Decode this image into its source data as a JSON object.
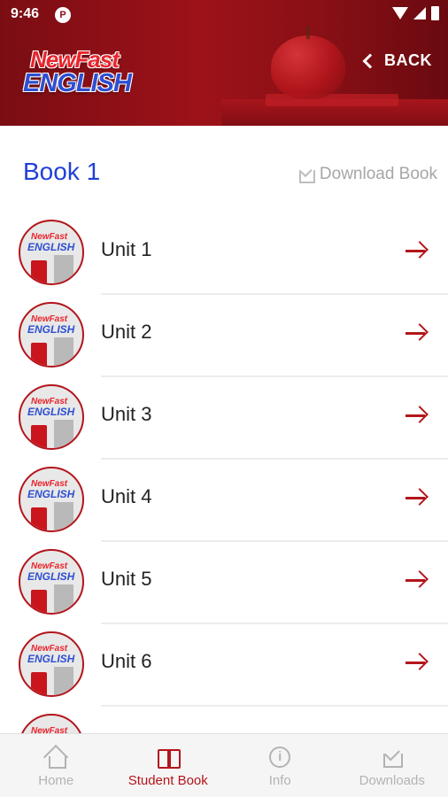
{
  "status_bar": {
    "time": "9:46",
    "notification_icon": "p-circle-icon"
  },
  "header": {
    "logo_line1": "NewFast",
    "logo_line2": "ENGLISH",
    "back_label": "BACK"
  },
  "book": {
    "title": "Book 1",
    "download_label": "Download Book"
  },
  "units": [
    {
      "label": "Unit 1"
    },
    {
      "label": "Unit 2"
    },
    {
      "label": "Unit 3"
    },
    {
      "label": "Unit 4"
    },
    {
      "label": "Unit 5"
    },
    {
      "label": "Unit 6"
    },
    {
      "label": ""
    }
  ],
  "bottom_nav": {
    "items": [
      {
        "label": "Home",
        "icon": "home-icon",
        "active": false
      },
      {
        "label": "Student Book",
        "icon": "book-icon",
        "active": true
      },
      {
        "label": "Info",
        "icon": "info-icon",
        "active": false
      },
      {
        "label": "Downloads",
        "icon": "downloads-icon",
        "active": false
      }
    ]
  },
  "colors": {
    "accent": "#b3151c",
    "title_blue": "#2140d8",
    "inactive": "#b3b3b3"
  }
}
